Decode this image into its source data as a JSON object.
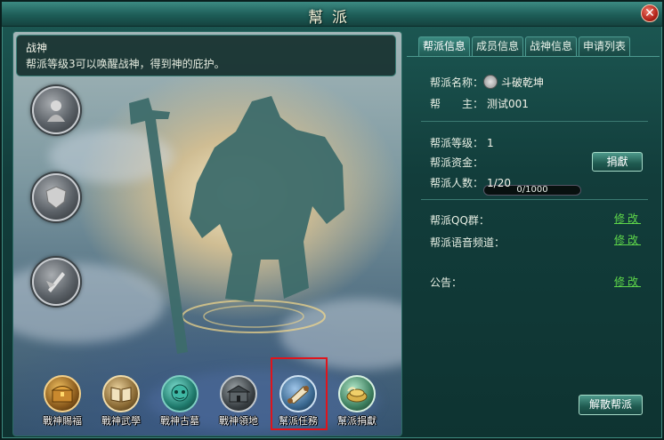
{
  "window": {
    "title": "幫派",
    "close_label": "✕"
  },
  "info": {
    "title": "战神",
    "description": "帮派等级3可以唤醒战神，得到神的庇护。"
  },
  "left_buttons": [
    {
      "icon": "warrior-portrait-icon"
    },
    {
      "icon": "shield-emblem-icon"
    },
    {
      "icon": "blade-emblem-icon"
    }
  ],
  "bottom_icons": [
    {
      "label": "戰神賜福",
      "icon": "treasure-chest-icon"
    },
    {
      "label": "戰神武學",
      "icon": "book-icon"
    },
    {
      "label": "戰神古墓",
      "icon": "tomb-icon"
    },
    {
      "label": "戰神領地",
      "icon": "territory-icon"
    },
    {
      "label": "幫派任務",
      "icon": "scroll-icon"
    },
    {
      "label": "幫派捐獻",
      "icon": "donation-icon"
    }
  ],
  "tabs": [
    {
      "label": "帮派信息",
      "active": true
    },
    {
      "label": "成员信息",
      "active": false
    },
    {
      "label": "战神信息",
      "active": false
    },
    {
      "label": "申请列表",
      "active": false
    }
  ],
  "guild": {
    "name_label": "帮派名称：",
    "name_value": "斗破乾坤",
    "leader_label": "帮　　主：",
    "leader_value": "测试001",
    "level_label": "帮派等级：",
    "level_value": "1",
    "funds_label": "帮派资金：",
    "funds_value": "0/1000",
    "funds_progress": 0,
    "members_label": "帮派人数：",
    "members_value": "1/20",
    "qq_label": "帮派QQ群：",
    "voice_label": "帮派语音频道：",
    "notice_label": "公告：",
    "edit_label": "修改",
    "donate_label": "捐獻",
    "disband_label": "解散帮派"
  },
  "colors": {
    "highlight": "#e0141c",
    "edit_link": "#5fd84a"
  }
}
